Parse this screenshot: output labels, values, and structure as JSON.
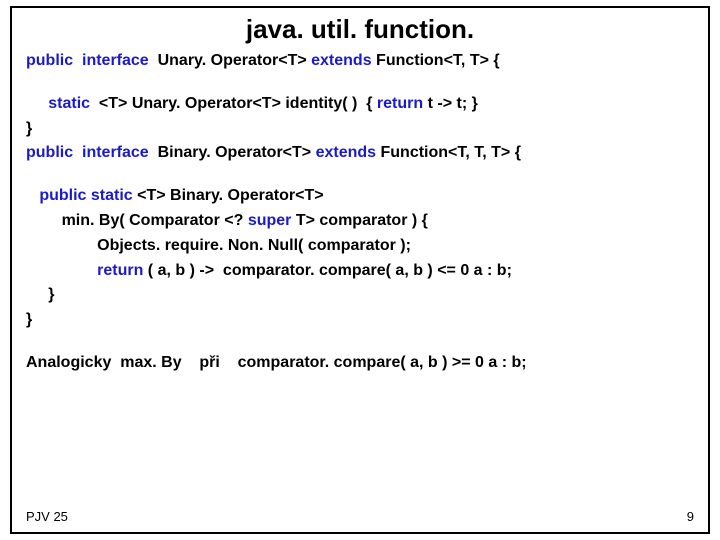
{
  "title": "java. util. function.",
  "kw": {
    "public": "public",
    "interface": "interface",
    "static": "static",
    "extends": "extends",
    "return": "return",
    "super": "super"
  },
  "txt": {
    "unaryDecl1": "  Unary. Operator<T> ",
    "unaryDecl2": " Function<T, T> {",
    "identity1": "  <T> Unary. Operator<T> identity( )  { ",
    "identity2": " t -> t; }",
    "closeBrace": "}",
    "binaryDecl1": "  Binary. Operator<T> ",
    "binaryDecl2": " Function<T, T, T> {",
    "minBy1": " <T> Binary. Operator<T>",
    "minBy2": "        min. By( Comparator <? ",
    "minBy2b": " T> comparator ) {",
    "minBy3": "                Objects. require. Non. Null( comparator );",
    "minBy4a": "                ",
    "minBy4b": " ( a, b ) ->  comparator. compare( a, b ) <= 0 a : b;",
    "innerClose": "     }",
    "analog": "Analogicky  max. By    při    comparator. compare( a, b ) >= 0 a : b;"
  },
  "footer": "PJV 25",
  "page": "9"
}
